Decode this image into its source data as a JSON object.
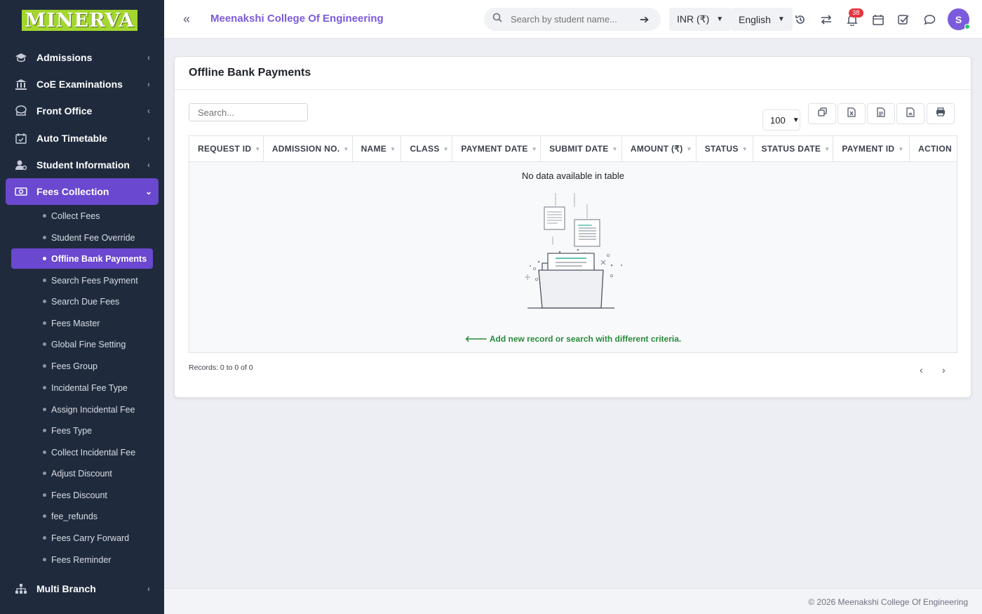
{
  "app": {
    "logo_text": "MINERVA"
  },
  "header": {
    "college_name": "Meenakshi College Of Engineering",
    "search_placeholder": "Search by student name...",
    "currency": "INR (₹)",
    "language": "English",
    "notification_count": "38",
    "avatar_initial": "S"
  },
  "sidebar": {
    "items": [
      {
        "label": "Admissions",
        "icon": "graduation-cap-icon"
      },
      {
        "label": "CoE Examinations",
        "icon": "institution-icon"
      },
      {
        "label": "Front Office",
        "icon": "front-office-icon"
      },
      {
        "label": "Auto Timetable",
        "icon": "calendar-check-icon"
      },
      {
        "label": "Student Information",
        "icon": "user-gear-icon"
      },
      {
        "label": "Fees Collection",
        "icon": "money-bill-icon",
        "active": true
      },
      {
        "label": "Multi Branch",
        "icon": "sitemap-icon"
      }
    ],
    "fees_sub_items": [
      "Collect Fees",
      "Student Fee Override",
      "Offline Bank Payments",
      "Search Fees Payment",
      "Search Due Fees",
      "Fees Master",
      "Global Fine Setting",
      "Fees Group",
      "Incidental Fee Type",
      "Assign Incidental Fee",
      "Fees Type",
      "Collect Incidental Fee",
      "Adjust Discount",
      "Fees Discount",
      "fee_refunds",
      "Fees Carry Forward",
      "Fees Reminder"
    ],
    "active_sub_item": "Offline Bank Payments"
  },
  "main": {
    "title": "Offline Bank Payments",
    "search_placeholder": "Search...",
    "page_length": "100",
    "columns": [
      "REQUEST ID",
      "ADMISSION NO.",
      "NAME",
      "CLASS",
      "PAYMENT DATE",
      "SUBMIT DATE",
      "AMOUNT (₹)",
      "STATUS",
      "STATUS DATE",
      "PAYMENT ID",
      "ACTION"
    ],
    "empty_message": "No data available in table",
    "empty_hint": "Add new record or search with different criteria.",
    "records_info": "Records: 0 to 0 of 0"
  },
  "footer": {
    "copyright": "© 2026 Meenakshi College Of Engineering"
  },
  "colors": {
    "accent": "#6a48cf",
    "sidebar_bg": "#1f2b3d",
    "brand_green": "#a3d72f",
    "hint_green": "#2a8a3e",
    "badge_red": "#e7343f"
  }
}
